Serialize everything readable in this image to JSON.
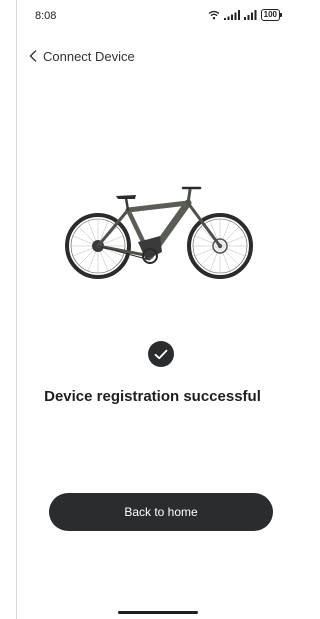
{
  "status_bar": {
    "time": "8:08",
    "battery": "100"
  },
  "header": {
    "title": "Connect Device"
  },
  "result": {
    "message": "Device registration successful"
  },
  "actions": {
    "home_label": "Back to home"
  },
  "colors": {
    "dark": "#2a2c2e",
    "bike_frame": "#5a5d55",
    "background": "#ffffff"
  }
}
